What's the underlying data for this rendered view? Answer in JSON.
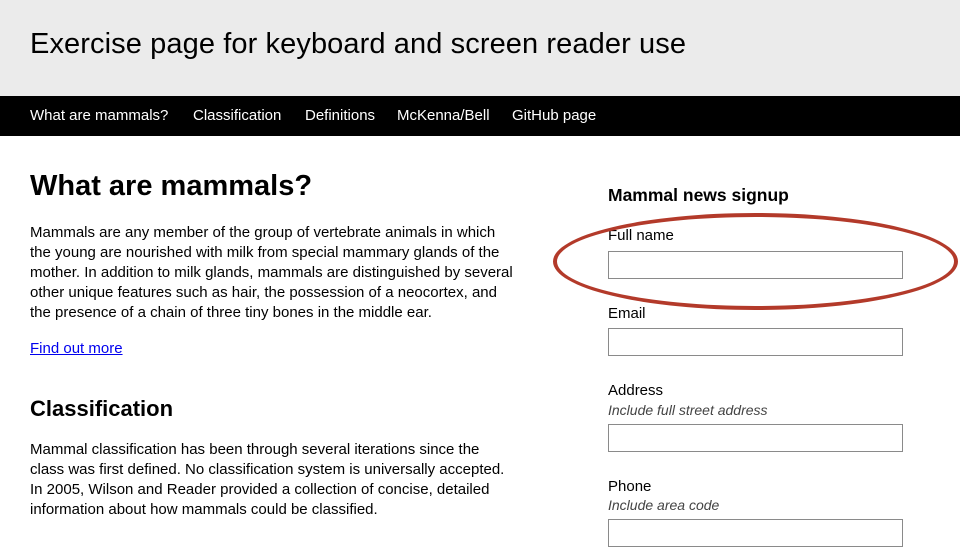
{
  "site": {
    "title": "Exercise page for keyboard and screen reader use"
  },
  "nav": {
    "items": [
      {
        "label": "What are mammals?"
      },
      {
        "label": "Classification"
      },
      {
        "label": "Definitions"
      },
      {
        "label": "McKenna/Bell"
      },
      {
        "label": "GitHub page"
      }
    ]
  },
  "main": {
    "section1": {
      "heading": "What are mammals?",
      "lines": [
        "Mammals are any member of the group of vertebrate animals in which",
        "the young are nourished with milk from special mammary glands of the",
        "mother. In addition to milk glands, mammals are distinguished by several",
        "other unique features such as hair, the possession of a neocortex, and",
        "the presence of a chain of three tiny bones in the middle ear."
      ],
      "link": "Find out more"
    },
    "section2": {
      "heading": "Classification",
      "lines": [
        "Mammal classification has been through several iterations since the",
        "class was first defined. No classification system is universally accepted.",
        "In 2005, Wilson and Reader provided a collection of concise, detailed",
        "information about how mammals could be classified."
      ]
    }
  },
  "form": {
    "title": "Mammal news signup",
    "fields": {
      "full_name": {
        "label": "Full name",
        "value": ""
      },
      "email": {
        "label": "Email",
        "value": ""
      },
      "address": {
        "label": "Address",
        "hint": "Include full street address",
        "value": ""
      },
      "phone": {
        "label": "Phone",
        "hint": "Include area code",
        "value": ""
      }
    }
  },
  "annotation": {
    "color": "#b33a2a",
    "shape": "ellipse",
    "highlights": "full-name-field"
  }
}
